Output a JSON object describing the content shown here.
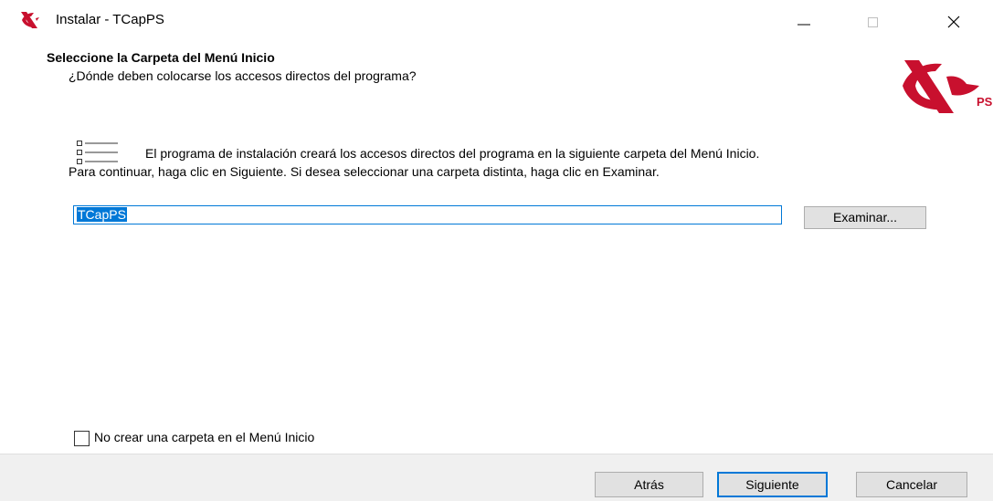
{
  "window": {
    "title": "Instalar - TCapPS",
    "app_icon": "tcapps-logo-icon",
    "controls": {
      "minimize": "minimize-icon",
      "maximize": "maximize-icon",
      "close": "close-icon"
    }
  },
  "header": {
    "title": "Seleccione la Carpeta del Menú Inicio",
    "subtitle": "¿Dónde deben colocarse los accesos directos del programa?",
    "logo_text": "PS"
  },
  "content": {
    "icon": "start-menu-list-icon",
    "info": "El programa de instalación creará los accesos directos del programa en la siguiente carpeta del Menú Inicio.",
    "instruction": "Para continuar, haga clic en Siguiente. Si desea seleccionar una carpeta distinta, haga clic en Examinar.",
    "folder_value": "TCapPS",
    "browse_label": "Examinar...",
    "no_folder_label": "No crear una carpeta en el Menú Inicio",
    "no_folder_checked": false
  },
  "footer": {
    "back_label": "Atrás",
    "next_label": "Siguiente",
    "cancel_label": "Cancelar"
  },
  "colors": {
    "accent": "#0078d7",
    "brand": "#c8102e",
    "footer_bg": "#f0f0f0",
    "button_bg": "#e1e1e1"
  }
}
